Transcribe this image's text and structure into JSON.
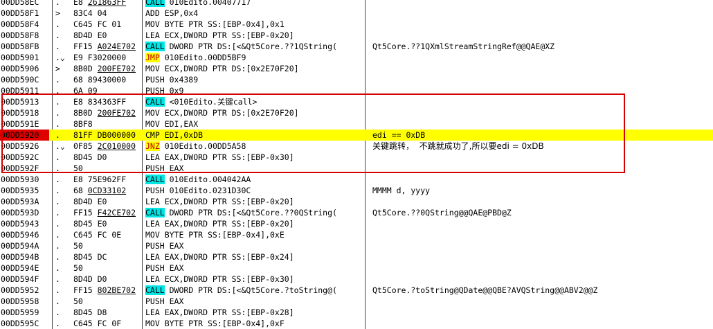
{
  "rows": [
    {
      "addr": "00DD58EC",
      "mark": ".",
      "hex_a": "E8 ",
      "hex_u": "261863FF",
      "hex_b": "",
      "mn": "CALL",
      "op": " 010Edito.00407717",
      "cmt": "",
      "hl": false,
      "sel": false
    },
    {
      "addr": "00DD58F1",
      "mark": ">",
      "hex_a": "83C4 04",
      "hex_u": "",
      "hex_b": "",
      "mn": "",
      "op": "ADD ESP,0x4",
      "cmt": "",
      "hl": false,
      "sel": false
    },
    {
      "addr": "00DD58F4",
      "mark": ".",
      "hex_a": "C645 FC 01",
      "hex_u": "",
      "hex_b": "",
      "mn": "",
      "op": "MOV BYTE PTR SS:[EBP-0x4],0x1",
      "cmt": "",
      "hl": false,
      "sel": false
    },
    {
      "addr": "00DD58F8",
      "mark": ".",
      "hex_a": "8D4D E0",
      "hex_u": "",
      "hex_b": "",
      "mn": "",
      "op": "LEA ECX,DWORD PTR SS:[EBP-0x20]",
      "cmt": "",
      "hl": false,
      "sel": false
    },
    {
      "addr": "00DD58FB",
      "mark": ".",
      "hex_a": "FF15 ",
      "hex_u": "A024E702",
      "hex_b": "",
      "mn": "CALL",
      "op": " DWORD PTR DS:[<&Qt5Core.??1QString(",
      "cmt": "Qt5Core.??1QXmlStreamStringRef@@QAE@XZ",
      "hl": false,
      "sel": false
    },
    {
      "addr": "00DD5901",
      "mark": ".⌄",
      "hex_a": "E9 F3020000",
      "hex_u": "",
      "hex_b": "",
      "mn": "JMP",
      "op": " 010Edito.00DD5BF9",
      "cmt": "",
      "hl": false,
      "sel": false
    },
    {
      "addr": "00DD5906",
      "mark": ">",
      "hex_a": "8B0D ",
      "hex_u": "200FE702",
      "hex_b": "",
      "mn": "",
      "op": "MOV ECX,DWORD PTR DS:[0x2E70F20]",
      "cmt": "",
      "hl": false,
      "sel": false
    },
    {
      "addr": "00DD590C",
      "mark": ".",
      "hex_a": "68 89430000",
      "hex_u": "",
      "hex_b": "",
      "mn": "",
      "op": "PUSH 0x4389",
      "cmt": "",
      "hl": false,
      "sel": false
    },
    {
      "addr": "00DD5911",
      "mark": ".",
      "hex_a": "6A 09",
      "hex_u": "",
      "hex_b": "",
      "mn": "",
      "op": "PUSH 0x9",
      "cmt": "",
      "hl": false,
      "sel": false
    },
    {
      "addr": "00DD5913",
      "mark": ".",
      "hex_a": "E8 834363FF",
      "hex_u": "",
      "hex_b": "",
      "mn": "CALL",
      "op": " <010Edito.关键call>",
      "cmt": "",
      "hl": false,
      "sel": false
    },
    {
      "addr": "00DD5918",
      "mark": ".",
      "hex_a": "8B0D ",
      "hex_u": "200FE702",
      "hex_b": "",
      "mn": "",
      "op": "MOV ECX,DWORD PTR DS:[0x2E70F20]",
      "cmt": "",
      "hl": false,
      "sel": false
    },
    {
      "addr": "00DD591E",
      "mark": ".",
      "hex_a": "8BF8",
      "hex_u": "",
      "hex_b": "",
      "mn": "",
      "op": "MOV EDI,EAX",
      "cmt": "",
      "hl": false,
      "sel": false
    },
    {
      "addr": "00DD5920",
      "mark": ".",
      "hex_a": "81FF DB000000",
      "hex_u": "",
      "hex_b": "",
      "mn": "",
      "op": "CMP EDI,0xDB",
      "cmt": "edi == 0xDB",
      "hl": true,
      "sel": true
    },
    {
      "addr": "00DD5926",
      "mark": ".⌄",
      "hex_a": "0F85 ",
      "hex_u": "2C010000",
      "hex_b": "",
      "mn": "JNZ",
      "op": " 010Edito.00DD5A58",
      "cmt": "关键跳转，  不跳就成功了,所以要edi = 0xDB",
      "hl": false,
      "sel": false
    },
    {
      "addr": "00DD592C",
      "mark": ".",
      "hex_a": "8D45 D0",
      "hex_u": "",
      "hex_b": "",
      "mn": "",
      "op": "LEA EAX,DWORD PTR SS:[EBP-0x30]",
      "cmt": "",
      "hl": false,
      "sel": false
    },
    {
      "addr": "00DD592F",
      "mark": ".",
      "hex_a": "50",
      "hex_u": "",
      "hex_b": "",
      "mn": "",
      "op": "PUSH EAX",
      "cmt": "",
      "hl": false,
      "sel": false
    },
    {
      "addr": "00DD5930",
      "mark": ".",
      "hex_a": "E8 75E962FF",
      "hex_u": "",
      "hex_b": "",
      "mn": "CALL",
      "op": " 010Edito.004042AA",
      "cmt": "",
      "hl": false,
      "sel": false
    },
    {
      "addr": "00DD5935",
      "mark": ".",
      "hex_a": "68 ",
      "hex_u": "0CD33102",
      "hex_b": "",
      "mn": "",
      "op": "PUSH 010Edito.0231D30C",
      "cmt": "MMMM d, yyyy",
      "hl": false,
      "sel": false
    },
    {
      "addr": "00DD593A",
      "mark": ".",
      "hex_a": "8D4D E0",
      "hex_u": "",
      "hex_b": "",
      "mn": "",
      "op": "LEA ECX,DWORD PTR SS:[EBP-0x20]",
      "cmt": "",
      "hl": false,
      "sel": false
    },
    {
      "addr": "00DD593D",
      "mark": ".",
      "hex_a": "FF15 ",
      "hex_u": "F42CE702",
      "hex_b": "",
      "mn": "CALL",
      "op": " DWORD PTR DS:[<&Qt5Core.??0QString(",
      "cmt": "Qt5Core.??0QString@@QAE@PBD@Z",
      "hl": false,
      "sel": false
    },
    {
      "addr": "00DD5943",
      "mark": ".",
      "hex_a": "8D45 E0",
      "hex_u": "",
      "hex_b": "",
      "mn": "",
      "op": "LEA EAX,DWORD PTR SS:[EBP-0x20]",
      "cmt": "",
      "hl": false,
      "sel": false
    },
    {
      "addr": "00DD5946",
      "mark": ".",
      "hex_a": "C645 FC 0E",
      "hex_u": "",
      "hex_b": "",
      "mn": "",
      "op": "MOV BYTE PTR SS:[EBP-0x4],0xE",
      "cmt": "",
      "hl": false,
      "sel": false
    },
    {
      "addr": "00DD594A",
      "mark": ".",
      "hex_a": "50",
      "hex_u": "",
      "hex_b": "",
      "mn": "",
      "op": "PUSH EAX",
      "cmt": "",
      "hl": false,
      "sel": false
    },
    {
      "addr": "00DD594B",
      "mark": ".",
      "hex_a": "8D45 DC",
      "hex_u": "",
      "hex_b": "",
      "mn": "",
      "op": "LEA EAX,DWORD PTR SS:[EBP-0x24]",
      "cmt": "",
      "hl": false,
      "sel": false
    },
    {
      "addr": "00DD594E",
      "mark": ".",
      "hex_a": "50",
      "hex_u": "",
      "hex_b": "",
      "mn": "",
      "op": "PUSH EAX",
      "cmt": "",
      "hl": false,
      "sel": false
    },
    {
      "addr": "00DD594F",
      "mark": ".",
      "hex_a": "8D4D D0",
      "hex_u": "",
      "hex_b": "",
      "mn": "",
      "op": "LEA ECX,DWORD PTR SS:[EBP-0x30]",
      "cmt": "",
      "hl": false,
      "sel": false
    },
    {
      "addr": "00DD5952",
      "mark": ".",
      "hex_a": "FF15 ",
      "hex_u": "802BE702",
      "hex_b": "",
      "mn": "CALL",
      "op": " DWORD PTR DS:[<&Qt5Core.?toString@(",
      "cmt": "Qt5Core.?toString@QDate@@QBE?AVQString@@ABV2@@Z",
      "hl": false,
      "sel": false
    },
    {
      "addr": "00DD5958",
      "mark": ".",
      "hex_a": "50",
      "hex_u": "",
      "hex_b": "",
      "mn": "",
      "op": "PUSH EAX",
      "cmt": "",
      "hl": false,
      "sel": false
    },
    {
      "addr": "00DD5959",
      "mark": ".",
      "hex_a": "8D45 D8",
      "hex_u": "",
      "hex_b": "",
      "mn": "",
      "op": "LEA EAX,DWORD PTR SS:[EBP-0x28]",
      "cmt": "",
      "hl": false,
      "sel": false
    },
    {
      "addr": "00DD595C",
      "mark": ".",
      "hex_a": "C645 FC 0F",
      "hex_u": "",
      "hex_b": "",
      "mn": "",
      "op": "MOV BYTE PTR SS:[EBP-0x4],0xF",
      "cmt": "",
      "hl": false,
      "sel": false
    }
  ],
  "colors": {
    "selected_row": "#ffff00",
    "address_highlight": "#e00000",
    "call_mark": "#00e6e6",
    "jump_text": "#c00000",
    "annotation_box": "#d40000"
  },
  "annotation_box": {
    "label": "key-jump-region"
  }
}
